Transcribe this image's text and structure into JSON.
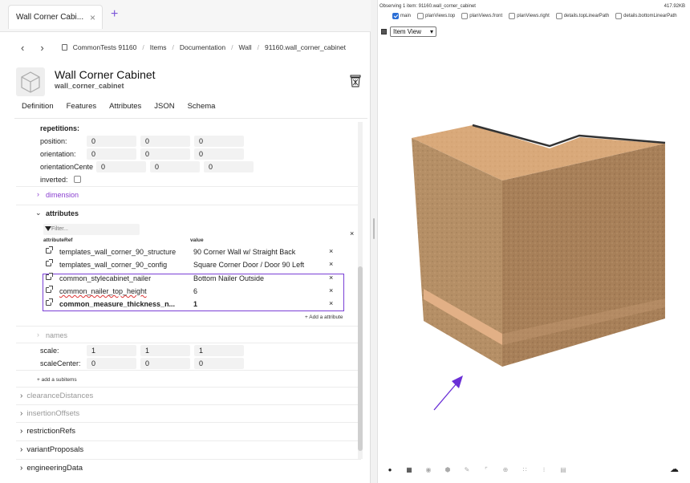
{
  "tab": {
    "title": "Wall Corner Cabi...",
    "close": "×",
    "new": "+"
  },
  "breadcrumb": [
    "CommonTests 91160",
    "Items",
    "Documentation",
    "Wall",
    "91160.wall_corner_cabinet"
  ],
  "header": {
    "title": "Wall Corner Cabinet",
    "subtitle": "wall_corner_cabinet"
  },
  "navtabs": [
    "Definition",
    "Features",
    "Attributes",
    "JSON",
    "Schema"
  ],
  "repetitions": {
    "heading": "repetitions:",
    "position": {
      "label": "position:",
      "values": [
        "0",
        "0",
        "0"
      ]
    },
    "orientation": {
      "label": "orientation:",
      "values": [
        "0",
        "0",
        "0"
      ]
    },
    "orientationCenter": {
      "label": "orientationCente",
      "values": [
        "0",
        "0",
        "0"
      ]
    },
    "inverted": {
      "label": "inverted:"
    }
  },
  "dimension": "dimension",
  "attributes": {
    "heading": "attributes",
    "filter_placeholder": "Filter...",
    "col_ref": "attributeRef",
    "col_value": "value",
    "clear": "×",
    "rows": [
      {
        "name": "templates_wall_corner_90_structure",
        "value": "90 Corner Wall w/ Straight Back",
        "remove": "×"
      },
      {
        "name": "templates_wall_corner_90_config",
        "value": "Square Corner Door / Door 90 Left",
        "remove": "×"
      },
      {
        "name": "common_stylecabinet_nailer",
        "value": "Bottom Nailer Outside",
        "remove": "×"
      },
      {
        "name": "common_nailer_top_height",
        "value": "6",
        "remove": "×"
      },
      {
        "name": "common_measure_thickness_n...",
        "value": "1",
        "remove": "×"
      }
    ],
    "add": "+ Add a attribute"
  },
  "names": "names",
  "scale": {
    "label": "scale:",
    "values": [
      "1",
      "1",
      "1"
    ]
  },
  "scaleCenter": {
    "label": "scaleCenter:",
    "values": [
      "0",
      "0",
      "0"
    ]
  },
  "add_subitems": "+ add a subitems",
  "sections": [
    {
      "label": "clearanceDistances",
      "muted": true
    },
    {
      "label": "insertionOffsets",
      "muted": true
    },
    {
      "label": "restrictionRefs",
      "muted": false
    },
    {
      "label": "variantProposals",
      "muted": false
    },
    {
      "label": "engineeringData",
      "muted": false
    }
  ],
  "viewer": {
    "observing": "Observing 1 item: 91160.wall_corner_cabinet",
    "size": "417.92KB",
    "checkboxes": [
      {
        "label": "main",
        "checked": true
      },
      {
        "label": "planViews.top",
        "checked": false
      },
      {
        "label": "planViews.front",
        "checked": false
      },
      {
        "label": "planViews.right",
        "checked": false
      },
      {
        "label": "details.topLinearPath",
        "checked": false
      },
      {
        "label": "details.bottomLinearPath",
        "checked": false
      }
    ],
    "view_select": "Item View"
  },
  "colors": {
    "accent": "#7a3fd6",
    "wood": "#b58a5e",
    "arrow": "#6a2fd6"
  }
}
